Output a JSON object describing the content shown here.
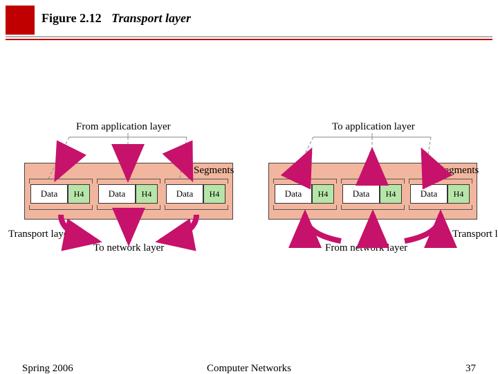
{
  "header": {
    "figure_number": "Figure 2.12",
    "figure_caption": "Transport layer"
  },
  "footer": {
    "term": "Spring 2006",
    "course": "Computer Networks",
    "page": "37"
  },
  "diagram": {
    "top_left_label": "From application layer",
    "top_right_label": "To application layer",
    "segments_label": "Segments",
    "transport_layer_label": "Transport layer",
    "bottom_left_label": "To network layer",
    "bottom_right_label": "From network layer",
    "cell_data": "Data",
    "cell_header": "H4"
  }
}
